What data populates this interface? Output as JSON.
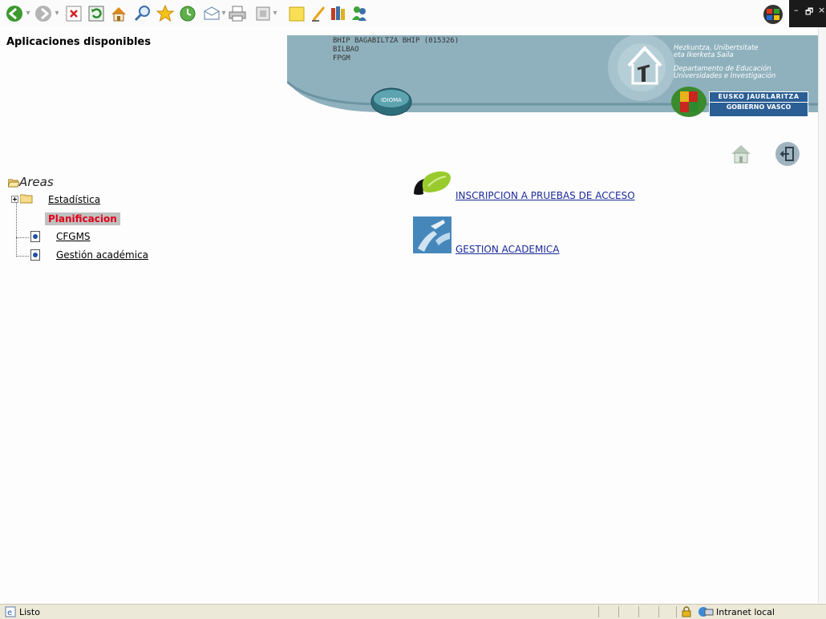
{
  "app": {
    "title": "Aplicaciones disponibles"
  },
  "banner": {
    "center_line1": "BHIP BAGABILTZA BHIP (015326)",
    "center_line2": "BILBAO",
    "center_line3": "FPGM",
    "idioma_label": "IDIOMA",
    "dept_eu_line1": "Hezkuntza, Unibertsitate",
    "dept_eu_line2": "eta Ikerketa Saila",
    "dept_es_line1": "Departamento de Educación",
    "dept_es_line2": "Universidades e Investigación",
    "gov_line1": "EUSKO JAURLARITZA",
    "gov_line2": "GOBIERNO VASCO",
    "colors": {
      "banner": "#8fb1bd",
      "banner_dark": "#6d94a3"
    }
  },
  "tree": {
    "root_label": "Areas",
    "items": [
      {
        "label": "Estadística",
        "type": "folder"
      },
      {
        "label": "Planificacion",
        "type": "selected"
      },
      {
        "label": "CFGMS",
        "type": "page"
      },
      {
        "label": "Gestión académica",
        "type": "page"
      }
    ]
  },
  "apps": [
    {
      "label": "INSCRIPCION A PRUEBAS DE ACCESO",
      "icon": "green-leaf-icon"
    },
    {
      "label": "GESTION ACADEMICA",
      "icon": "hands-photo-icon"
    }
  ],
  "statusbar": {
    "status": "Listo",
    "zone": "Intranet local"
  }
}
